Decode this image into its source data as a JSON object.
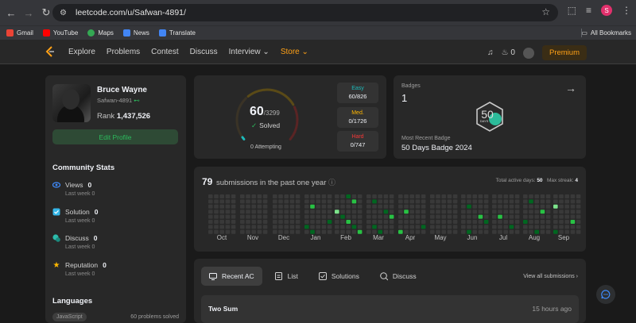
{
  "browser": {
    "url": "leetcode.com/u/Safwan-4891/",
    "profile_initial": "S",
    "bookmarks": [
      {
        "label": "Gmail",
        "color": "#ea4335"
      },
      {
        "label": "YouTube",
        "color": "#ff0000"
      },
      {
        "label": "Maps",
        "color": "#34a853"
      },
      {
        "label": "News",
        "color": "#4285f4"
      },
      {
        "label": "Translate",
        "color": "#4285f4"
      }
    ],
    "all_bookmarks": "All Bookmarks"
  },
  "nav": {
    "links": [
      "Explore",
      "Problems",
      "Contest",
      "Discuss",
      "Interview ⌄",
      "Store ⌄"
    ],
    "streak": "0",
    "premium": "Premium"
  },
  "profile": {
    "name": "Bruce Wayne",
    "username": "Safwan-4891",
    "rank_label": "Rank",
    "rank": "1,437,526",
    "edit": "Edit Profile"
  },
  "community": {
    "title": "Community Stats",
    "stats": [
      {
        "label": "Views",
        "value": "0",
        "sub": "Last week 0",
        "icon": "eye-icon",
        "color": "#3f8cff"
      },
      {
        "label": "Solution",
        "value": "0",
        "sub": "Last week 0",
        "icon": "solution-icon",
        "color": "#35b6e8"
      },
      {
        "label": "Discuss",
        "value": "0",
        "sub": "Last week 0",
        "icon": "discuss-icon",
        "color": "#2cbbab"
      },
      {
        "label": "Reputation",
        "value": "0",
        "sub": "Last week 0",
        "icon": "star-icon",
        "color": "#ffb800"
      }
    ]
  },
  "languages": {
    "title": "Languages",
    "items": [
      {
        "name": "JavaScript",
        "count": "60 problems solved"
      }
    ]
  },
  "solved": {
    "count": "60",
    "total": "/3299",
    "label": "Solved",
    "attempting": "0 Attempting",
    "fraction": 0.0182,
    "difficulties": [
      {
        "label": "Easy",
        "value": "60/826",
        "color": "#1cbaba"
      },
      {
        "label": "Med.",
        "value": "0/1726",
        "color": "#ffb700"
      },
      {
        "label": "Hard",
        "value": "0/747",
        "color": "#f63737"
      }
    ]
  },
  "badges": {
    "label": "Badges",
    "count": "1",
    "recent_label": "Most Recent Badge",
    "recent_name": "50 Days Badge 2024",
    "badge_text": "DAYS",
    "badge_number": "50"
  },
  "submissions": {
    "count": "79",
    "text": "submissions in the past one year",
    "active_label": "Total active days:",
    "active_days": "50",
    "streak_label": "Max streak:",
    "max_streak": "4",
    "months": [
      "Oct",
      "Nov",
      "Dec",
      "Jan",
      "Feb",
      "Mar",
      "Apr",
      "May",
      "Jun",
      "Jul",
      "Aug",
      "Sep"
    ],
    "colors": {
      "empty": "#393939",
      "l1": "#016620",
      "l2": "#28c244",
      "l3": "#7ce38b"
    }
  },
  "recent": {
    "tabs": [
      "Recent AC",
      "List",
      "Solutions",
      "Discuss"
    ],
    "view_all": "View all submissions  ›",
    "items": [
      {
        "title": "Two Sum",
        "time": "15 hours ago"
      }
    ]
  }
}
